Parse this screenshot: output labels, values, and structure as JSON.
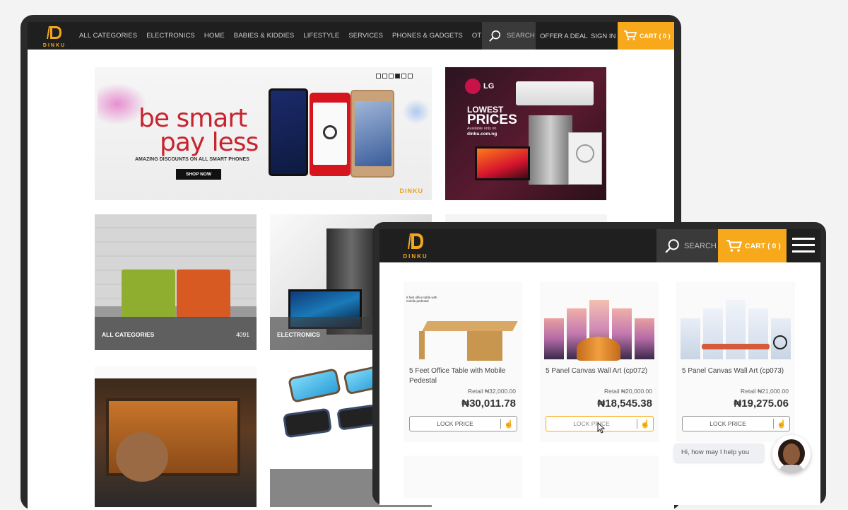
{
  "brand": {
    "logo_text": "DINKU"
  },
  "desktop": {
    "nav": {
      "categories": [
        "ALL CATEGORIES",
        "ELECTRONICS",
        "HOME",
        "BABIES & KIDDIES",
        "LIFESTYLE",
        "SERVICES",
        "PHONES & GADGETS",
        "OTHERS"
      ],
      "search_label": "SEARCH",
      "offer_label": "OFFER A DEAL",
      "signin_label": "SIGN IN",
      "cart_label": "CART ( 0 )"
    },
    "hero": {
      "line1": "be smart",
      "line2": "pay less",
      "subtitle": "AMAZING DISCOUNTS ON ALL SMART PHONES",
      "button": "SHOP NOW",
      "brand": "DINKU",
      "slides": 6,
      "active_slide": 4
    },
    "lg_banner": {
      "brand": "LG",
      "line1": "LOWEST",
      "line2": "PRICES",
      "line3": "Available only on",
      "line4": "dinku.com.ng"
    },
    "tiles": [
      {
        "label": "ALL CATEGORIES",
        "count": "4091"
      },
      {
        "label": "ELECTRONICS",
        "count": ""
      }
    ]
  },
  "tablet": {
    "nav": {
      "search_label": "SEARCH",
      "cart_label": "CART ( 0 )"
    },
    "products": [
      {
        "name": "5 Feet Office Table with Mobile Pedestal",
        "retail": "Retail ₦32,000.00",
        "price": "₦30,011.78",
        "button": "LOCK PRICE",
        "img_caption": "5 feet office table with mobile pedestal"
      },
      {
        "name": "5 Panel Canvas Wall Art (cp072)",
        "retail": "Retail ₦20,000.00",
        "price": "₦18,545.38",
        "button": "LOCK PRICE"
      },
      {
        "name": "5 Panel Canvas Wall Art (cp073)",
        "retail": "Retail ₦21,000.00",
        "price": "₦19,275.06",
        "button": "LOCK PRICE"
      }
    ]
  },
  "chat": {
    "message": "Hi, how may I help you"
  },
  "colors": {
    "accent": "#f7a81b",
    "nav_bg": "#1f1f1f",
    "hero_red": "#c8242f"
  }
}
